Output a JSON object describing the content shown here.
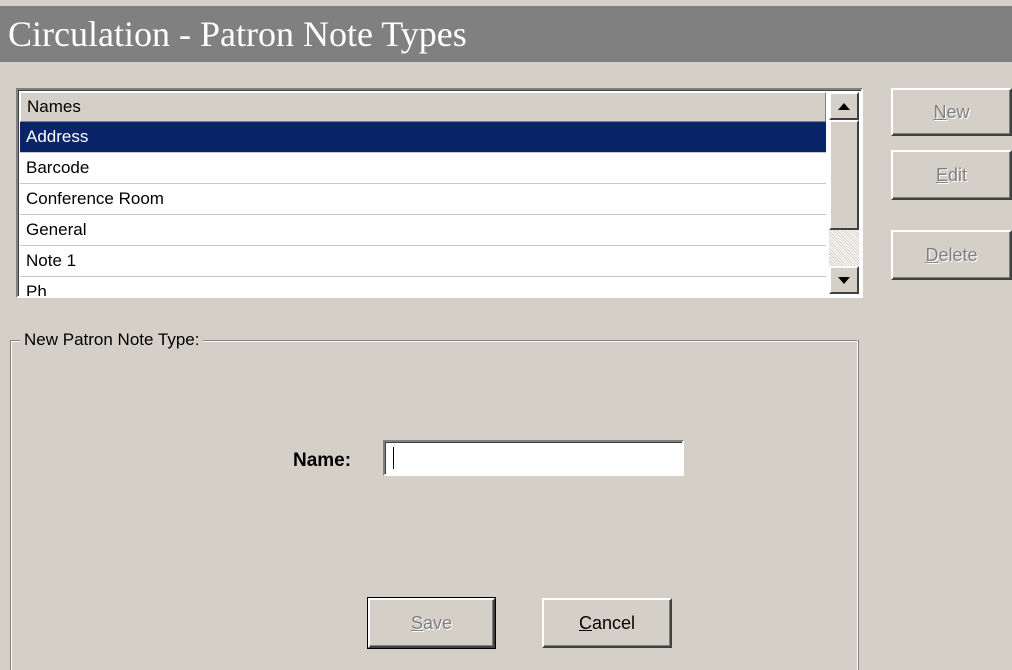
{
  "window": {
    "title": "Circulation - Patron Note Types"
  },
  "list": {
    "column_header": "Names",
    "rows": [
      {
        "label": "Address",
        "selected": true
      },
      {
        "label": "Barcode",
        "selected": false
      },
      {
        "label": "Conference Room",
        "selected": false
      },
      {
        "label": "General",
        "selected": false
      },
      {
        "label": "Note 1",
        "selected": false
      },
      {
        "label": "Ph",
        "selected": false
      }
    ],
    "scroll_up_icon": "triangle-up-icon",
    "scroll_down_icon": "triangle-down-icon"
  },
  "side_buttons": {
    "new_mnemonic": "N",
    "new_rest": "ew",
    "edit_mnemonic": "E",
    "edit_rest": "dit",
    "delete_mnemonic": "D",
    "delete_rest": "elete"
  },
  "form": {
    "group_title": "New  Patron Note Type:",
    "name_label": "Name:",
    "name_value": "",
    "save_mnemonic": "S",
    "save_rest": "ave",
    "cancel_mnemonic": "C",
    "cancel_rest": "ancel"
  },
  "colors": {
    "selection": "#0a246a",
    "title_bar": "#808080",
    "face": "#d4d0c8"
  }
}
